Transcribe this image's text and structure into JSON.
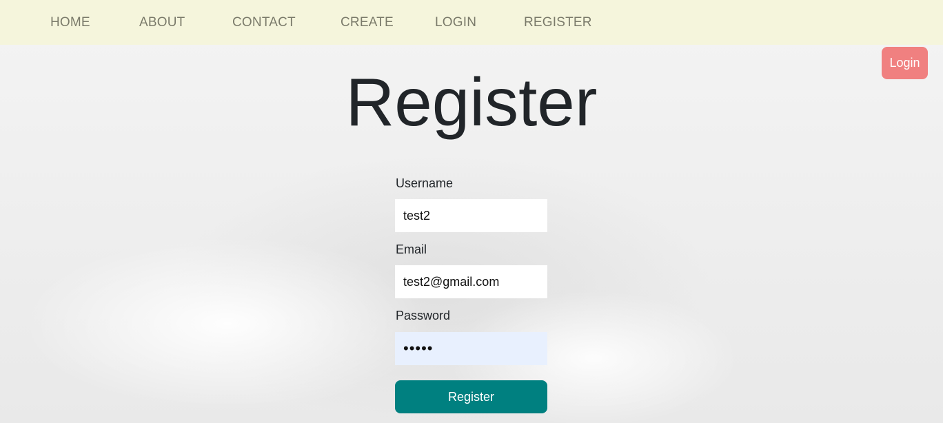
{
  "nav": {
    "items": [
      "HOME",
      "ABOUT",
      "CONTACT",
      "CREATE",
      "LOGIN",
      "REGISTER"
    ]
  },
  "corner_button": {
    "label": "Login"
  },
  "page": {
    "title": "Register"
  },
  "form": {
    "username": {
      "label": "Username",
      "value": "test2"
    },
    "email": {
      "label": "Email",
      "value": "test2@gmail.com"
    },
    "password": {
      "label": "Password",
      "value": "•••••"
    },
    "submit_label": "Register"
  },
  "colors": {
    "navbar_background": "#f5f5dc",
    "corner_button": "#f08080",
    "submit_button": "#008080",
    "password_autofill": "#e8f0fe"
  }
}
